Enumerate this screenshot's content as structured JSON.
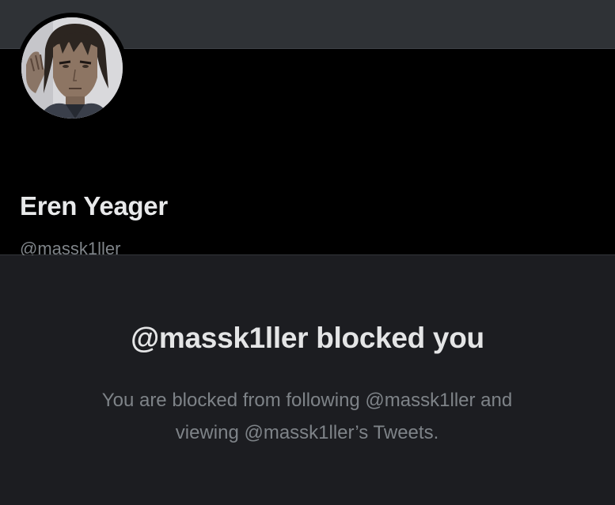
{
  "profile": {
    "display_name": "Eren Yeager",
    "handle": "@massk1ller",
    "avatar": "avatar-photo"
  },
  "blocked_notice": {
    "title": "@massk1ller blocked you",
    "description": "You are blocked from following @massk1ller and viewing @massk1ller’s Tweets."
  },
  "colors": {
    "banner": "#2f3236",
    "header_bg": "#000000",
    "page_bg": "#1c1d21",
    "primary_text": "#e8e9ea",
    "secondary_text": "#7f8489"
  }
}
